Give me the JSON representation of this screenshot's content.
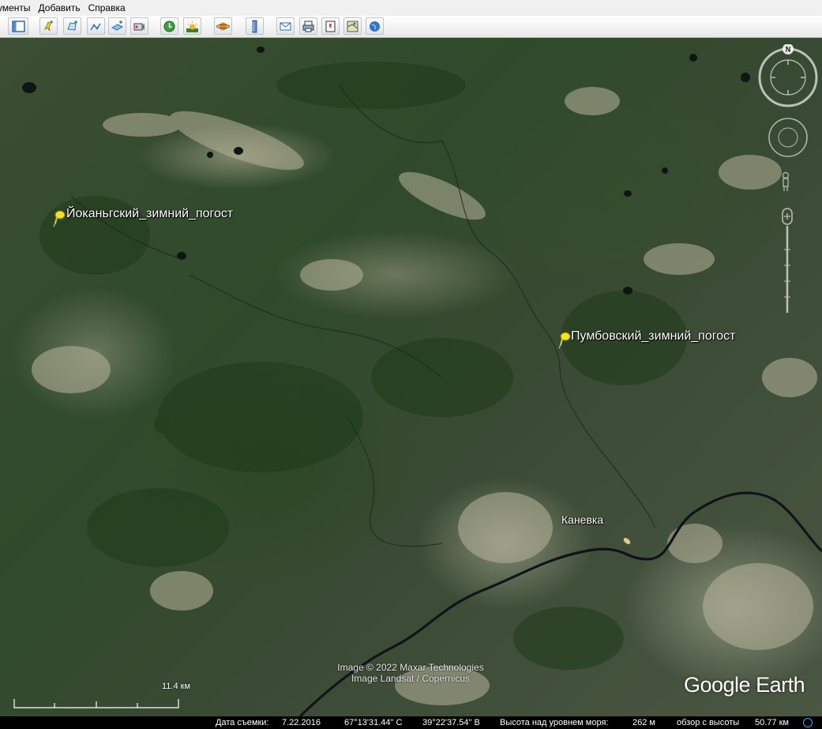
{
  "menu": {
    "items": [
      {
        "label": "ументы"
      },
      {
        "label": "Добавить"
      },
      {
        "label": "Справка"
      }
    ]
  },
  "toolbar": {
    "buttons": [
      {
        "icon": "sidebar-toggle-icon"
      },
      {
        "icon": "add-placemark-icon"
      },
      {
        "icon": "add-polygon-icon"
      },
      {
        "icon": "add-path-icon"
      },
      {
        "icon": "add-image-overlay-icon"
      },
      {
        "icon": "record-tour-icon"
      },
      {
        "icon": "historical-imagery-icon"
      },
      {
        "icon": "sunlight-icon"
      },
      {
        "icon": "planets-icon"
      },
      {
        "icon": "ruler-icon"
      },
      {
        "icon": "email-icon"
      },
      {
        "icon": "print-icon"
      },
      {
        "icon": "save-image-icon"
      },
      {
        "icon": "view-in-maps-icon"
      },
      {
        "icon": "globe-icon"
      }
    ]
  },
  "map": {
    "placemarks": [
      {
        "label": "Йоканьгский_зимний_погост"
      },
      {
        "label": "Пумбовский_зимний_погост"
      }
    ],
    "town": {
      "label": "Каневка"
    },
    "attribution": [
      "Image © 2022 Maxar Technologies",
      "Image Landsat / Copernicus"
    ],
    "logo": {
      "google": "Google",
      "earth": "Earth"
    },
    "scale": {
      "label": "11.4 км"
    },
    "compass": {
      "north": "N"
    }
  },
  "status": {
    "imagery_date_label": "Дата съемки:",
    "imagery_date": "7.22.2016",
    "latitude": "67°13'31.44\" С",
    "longitude": "39°22'37.54\" В",
    "elevation_label": "Высота над уровнем моря:",
    "elevation": "262 м",
    "eye_alt_label": "обзор с высоты",
    "eye_alt": "50.77 км"
  },
  "colors": {
    "river": "#10141a",
    "pin": "#f5e21a",
    "statusbar": "#000000"
  }
}
